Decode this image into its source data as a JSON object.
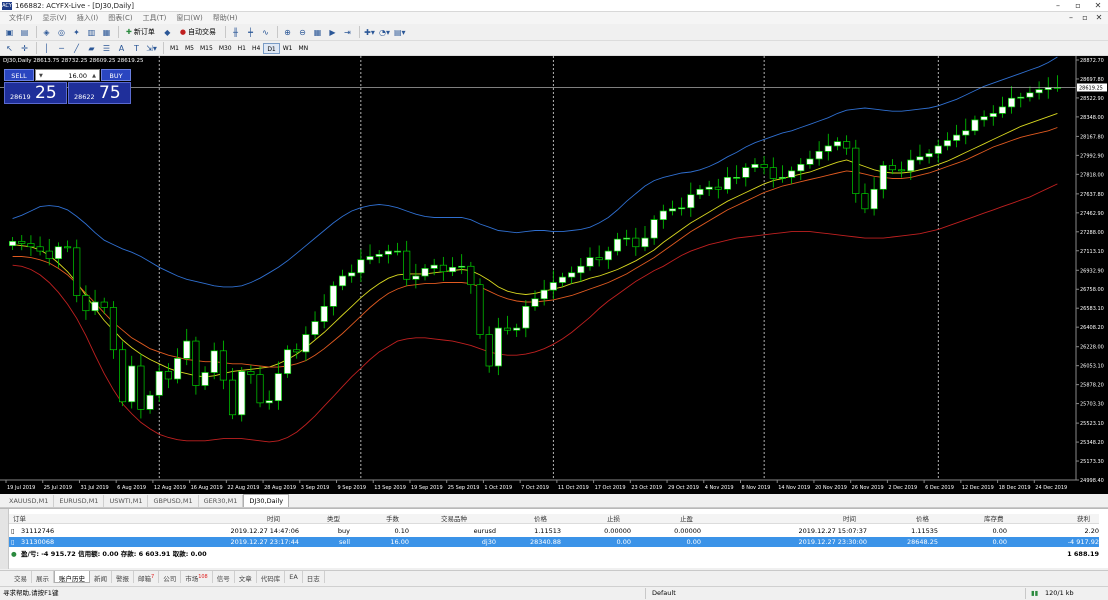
{
  "window": {
    "title": "166882: ACYFX-Live - [DJ30,Daily]",
    "app_icon": "ACY",
    "buttons": [
      "–",
      "▫",
      "✕"
    ]
  },
  "menu": {
    "items": [
      "文件(F)",
      "显示(V)",
      "插入(I)",
      "图表(C)",
      "工具(T)",
      "窗口(W)",
      "帮助(H)"
    ],
    "mdi_buttons": [
      "–",
      "▫",
      "✕"
    ]
  },
  "toolbar": {
    "new_order_label": "新订单",
    "autotrade_label": "自动交易",
    "timeframes": [
      "M1",
      "M5",
      "M15",
      "M30",
      "H1",
      "H4",
      "D1",
      "W1",
      "MN"
    ],
    "active_timeframe": "D1"
  },
  "chart": {
    "label": "DJ30,Daily  28613.75 28732.25 28609.25 28619.25",
    "current_price": "28619.25",
    "price_axis": [
      "28872.70",
      "28697.80",
      "28522.90",
      "28348.00",
      "28167.80",
      "27992.90",
      "27818.00",
      "27637.80",
      "27462.90",
      "27288.00",
      "27113.10",
      "26932.90",
      "26758.00",
      "26583.10",
      "26408.20",
      "26228.00",
      "26053.10",
      "25878.20",
      "25703.30",
      "25523.10",
      "25348.20",
      "25173.30",
      "24998.40"
    ],
    "date_axis": [
      "19 Jul 2019",
      "25 Jul 2019",
      "31 Jul 2019",
      "6 Aug 2019",
      "12 Aug 2019",
      "16 Aug 2019",
      "22 Aug 2019",
      "28 Aug 2019",
      "3 Sep 2019",
      "9 Sep 2019",
      "13 Sep 2019",
      "19 Sep 2019",
      "25 Sep 2019",
      "1 Oct 2019",
      "7 Oct 2019",
      "11 Oct 2019",
      "17 Oct 2019",
      "23 Oct 2019",
      "29 Oct 2019",
      "4 Nov 2019",
      "8 Nov 2019",
      "14 Nov 2019",
      "20 Nov 2019",
      "26 Nov 2019",
      "2 Dec 2019",
      "6 Dec 2019",
      "12 Dec 2019",
      "18 Dec 2019",
      "24 Dec 2019"
    ],
    "colors": {
      "background": "#000000",
      "bull": "#ffffff",
      "bear": "#000000",
      "wick": "#00d000",
      "upper_band": "#2f6fd0",
      "ma_fast": "#d8d820",
      "ma_mid": "#e05a20",
      "lower_band": "#c02020",
      "grid_period": "#dddddd"
    }
  },
  "chart_data": {
    "type": "candlestick",
    "symbol": "DJ30",
    "timeframe": "Daily",
    "ohlc_last": {
      "open": 28613.75,
      "high": 28732.25,
      "low": 28609.25,
      "close": 28619.25
    },
    "ylim": [
      24998.4,
      28872.7
    ],
    "closes": [
      27200,
      27180,
      27150,
      27110,
      27040,
      27150,
      27140,
      26700,
      26560,
      26640,
      26590,
      26200,
      25720,
      26050,
      25650,
      25780,
      26000,
      25930,
      26120,
      26280,
      25870,
      25990,
      26190,
      25920,
      25600,
      26000,
      25970,
      25710,
      25730,
      25980,
      26200,
      26180,
      26340,
      26460,
      26600,
      26790,
      26880,
      26910,
      27030,
      27060,
      27080,
      27110,
      27110,
      26850,
      26880,
      26950,
      26980,
      26920,
      26960,
      26970,
      26800,
      26340,
      26050,
      26400,
      26380,
      26400,
      26600,
      26670,
      26750,
      26820,
      26870,
      26910,
      26970,
      27050,
      27030,
      27110,
      27220,
      27230,
      27150,
      27230,
      27400,
      27480,
      27500,
      27510,
      27630,
      27680,
      27700,
      27680,
      27790,
      27790,
      27880,
      27910,
      27880,
      27780,
      27790,
      27850,
      27910,
      27960,
      28030,
      28080,
      28120,
      28060,
      27640,
      27500,
      27680,
      27900,
      27860,
      27850,
      27950,
      27980,
      28010,
      28080,
      28130,
      28180,
      28220,
      28320,
      28350,
      28380,
      28440,
      28520,
      28530,
      28570,
      28600,
      28620,
      28619.25
    ],
    "series": [
      {
        "name": "upper_band",
        "values": [
          27410,
          27440,
          27480,
          27520,
          27530,
          27520,
          27490,
          27430,
          27360,
          27280,
          27210,
          27170,
          27130,
          27100,
          27060,
          27010,
          26960,
          26920,
          26880,
          26850,
          26830,
          26810,
          26790,
          26780,
          26780,
          26790,
          26820,
          26860,
          26910,
          26960,
          27020,
          27090,
          27160,
          27230,
          27300,
          27370,
          27430,
          27480,
          27510,
          27530,
          27540,
          27530,
          27510,
          27480,
          27450,
          27430,
          27420,
          27420,
          27420,
          27420,
          27400,
          27360,
          27330,
          27300,
          27290,
          27280,
          27290,
          27300,
          27300,
          27290,
          27290,
          27300,
          27310,
          27330,
          27370,
          27420,
          27490,
          27570,
          27640,
          27710,
          27760,
          27790,
          27810,
          27830,
          27840,
          27860,
          27890,
          27930,
          27980,
          28020,
          28070,
          28110,
          28140,
          28170,
          28200,
          28220,
          28250,
          28280,
          28310,
          28340,
          28380,
          28410,
          28420,
          28430,
          28420,
          28410,
          28400,
          28400,
          28410,
          28420,
          28430,
          28450,
          28480,
          28510,
          28550,
          28590,
          28630,
          28660,
          28690,
          28720,
          28750,
          28780,
          28810,
          28850,
          28900
        ]
      },
      {
        "name": "ma_fast",
        "values": [
          27170,
          27160,
          27150,
          27120,
          27070,
          27000,
          26920,
          26820,
          26700,
          26580,
          26470,
          26380,
          26290,
          26220,
          26160,
          26110,
          26070,
          26030,
          26000,
          25980,
          25960,
          25950,
          25960,
          25980,
          26000,
          26010,
          26020,
          26030,
          26040,
          26070,
          26110,
          26160,
          26220,
          26290,
          26360,
          26440,
          26520,
          26600,
          26680,
          26750,
          26810,
          26860,
          26890,
          26900,
          26900,
          26900,
          26910,
          26920,
          26930,
          26940,
          26930,
          26890,
          26840,
          26780,
          26740,
          26720,
          26710,
          26720,
          26740,
          26760,
          26780,
          26810,
          26830,
          26860,
          26880,
          26910,
          26940,
          26980,
          27020,
          27070,
          27120,
          27190,
          27250,
          27310,
          27370,
          27420,
          27470,
          27520,
          27570,
          27610,
          27650,
          27690,
          27730,
          27760,
          27780,
          27800,
          27820,
          27840,
          27870,
          27900,
          27930,
          27950,
          27920,
          27890,
          27860,
          27840,
          27830,
          27830,
          27840,
          27860,
          27880,
          27910,
          27940,
          27980,
          28020,
          28060,
          28100,
          28140,
          28180,
          28220,
          28260,
          28290,
          28320,
          28350,
          28380
        ]
      },
      {
        "name": "ma_mid",
        "values": [
          27060,
          27060,
          27050,
          27030,
          27000,
          26950,
          26890,
          26810,
          26720,
          26630,
          26540,
          26450,
          26380,
          26310,
          26260,
          26210,
          26180,
          26150,
          26130,
          26110,
          26100,
          26090,
          26090,
          26080,
          26070,
          26070,
          26060,
          26050,
          26040,
          26040,
          26050,
          26070,
          26100,
          26150,
          26210,
          26280,
          26350,
          26430,
          26510,
          26590,
          26660,
          26720,
          26760,
          26790,
          26800,
          26810,
          26810,
          26820,
          26820,
          26820,
          26810,
          26780,
          26740,
          26700,
          26670,
          26650,
          26640,
          26640,
          26650,
          26660,
          26680,
          26700,
          26730,
          26760,
          26790,
          26820,
          26860,
          26900,
          26950,
          27000,
          27050,
          27110,
          27170,
          27230,
          27290,
          27340,
          27390,
          27440,
          27490,
          27530,
          27570,
          27610,
          27650,
          27680,
          27710,
          27730,
          27750,
          27770,
          27790,
          27810,
          27830,
          27850,
          27840,
          27820,
          27800,
          27790,
          27780,
          27780,
          27790,
          27810,
          27830,
          27860,
          27890,
          27920,
          27950,
          27990,
          28030,
          28070,
          28100,
          28130,
          28160,
          28180,
          28200,
          28220,
          28250
        ]
      },
      {
        "name": "lower_band",
        "values": [
          26980,
          26970,
          26940,
          26890,
          26820,
          26730,
          26620,
          26490,
          26330,
          26150,
          25980,
          25830,
          25700,
          25610,
          25530,
          25470,
          25420,
          25390,
          25370,
          25360,
          25360,
          25360,
          25370,
          25380,
          25380,
          25380,
          25370,
          25360,
          25350,
          25360,
          25390,
          25440,
          25510,
          25590,
          25680,
          25770,
          25860,
          25950,
          26030,
          26110,
          26180,
          26230,
          26280,
          26300,
          26310,
          26310,
          26300,
          26290,
          26280,
          26260,
          26240,
          26210,
          26180,
          26160,
          26150,
          26150,
          26160,
          26180,
          26210,
          26250,
          26300,
          26360,
          26430,
          26500,
          26580,
          26650,
          26710,
          26770,
          26830,
          26880,
          26930,
          26970,
          27020,
          27070,
          27110,
          27140,
          27170,
          27190,
          27210,
          27230,
          27240,
          27250,
          27260,
          27270,
          27280,
          27290,
          27290,
          27290,
          27280,
          27270,
          27260,
          27250,
          27240,
          27230,
          27230,
          27230,
          27240,
          27250,
          27260,
          27270,
          27290,
          27310,
          27340,
          27370,
          27400,
          27430,
          27460,
          27490,
          27520,
          27550,
          27580,
          27610,
          27650,
          27690,
          27730
        ]
      }
    ],
    "period_separator_index": [
      16,
      38,
      59,
      82,
      101
    ]
  },
  "one_click": {
    "sell_label": "SELL",
    "buy_label": "BUY",
    "lot": "16.00",
    "sell_small": "28619",
    "sell_big": "25",
    "buy_small": "28622",
    "buy_big": "75"
  },
  "symbol_tabs": [
    "XAUUSD,M1",
    "EURUSD,M1",
    "USWTI,M1",
    "GBPUSD,M1",
    "GER30,M1",
    "DJ30,Daily"
  ],
  "active_symbol_tab": "DJ30,Daily",
  "terminal": {
    "headers": {
      "order": "订单",
      "time": "时间",
      "type": "类型",
      "lots": "手数",
      "symbol": "交易品种",
      "price": "价格",
      "sl": "止损",
      "tp": "止盈",
      "close_time": "时间",
      "close_price": "价格",
      "swap": "库存费",
      "profit": "获利"
    },
    "rows": [
      {
        "order": "31112746",
        "time": "2019.12.27 14:47:06",
        "type": "buy",
        "lots": "0.10",
        "symbol": "eurusd",
        "price": "1.11513",
        "sl": "0.00000",
        "tp": "0.00000",
        "close_time": "2019.12.27 15:07:37",
        "close_price": "1.11535",
        "swap": "0.00",
        "profit": "2.20"
      },
      {
        "order": "31130068",
        "time": "2019.12.27 23:17:44",
        "type": "sell",
        "lots": "16.00",
        "symbol": "dj30",
        "price": "28340.88",
        "sl": "0.00",
        "tp": "0.00",
        "close_time": "2019.12.27 23:30:00",
        "close_price": "28648.25",
        "swap": "0.00",
        "profit": "-4 917.92"
      }
    ],
    "summary": "盈/亏: -4 915.72  信用额: 0.00  存款: 6 603.91  取款: 0.00",
    "summary_total": "1 688.19"
  },
  "bottom_tabs": [
    {
      "label": "交易"
    },
    {
      "label": "展示"
    },
    {
      "label": "账户历史",
      "active": true
    },
    {
      "label": "新闻"
    },
    {
      "label": "警报"
    },
    {
      "label": "邮箱",
      "badge": "7"
    },
    {
      "label": "公司"
    },
    {
      "label": "市场",
      "badge": "108"
    },
    {
      "label": "信号"
    },
    {
      "label": "文章"
    },
    {
      "label": "代码库"
    },
    {
      "label": "EA"
    },
    {
      "label": "日志"
    }
  ],
  "status": {
    "help": "寻求帮助,请按F1键",
    "profile": "Default",
    "traffic": "120/1 kb"
  }
}
